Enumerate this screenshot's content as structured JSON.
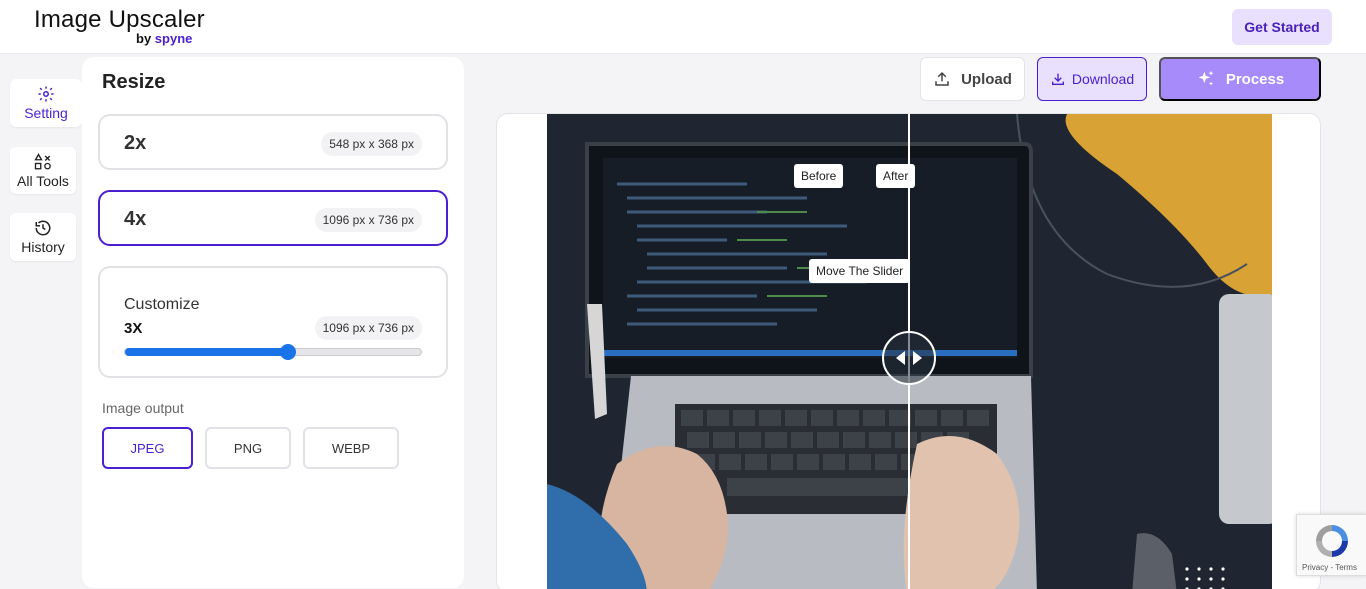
{
  "header": {
    "logo_title": "Image Upscaler",
    "logo_by": "by",
    "logo_brand": "spyne",
    "get_started": "Get Started"
  },
  "rail": {
    "setting": "Setting",
    "all_tools": "All Tools",
    "history": "History"
  },
  "panel": {
    "title": "Resize",
    "options": [
      {
        "label": "2x",
        "dims": "548 px x 368 px"
      },
      {
        "label": "4x",
        "dims": "1096 px x 736 px"
      }
    ],
    "customize": {
      "title": "Customize",
      "value": "3X",
      "dims": "1096 px x 736 px",
      "slider_fraction": 0.55
    },
    "output_label": "Image output",
    "formats": [
      "JPEG",
      "PNG",
      "WEBP"
    ],
    "selected_format": "JPEG"
  },
  "toolbar": {
    "upload": "Upload",
    "download": "Download",
    "process": "Process"
  },
  "viewer": {
    "before": "Before",
    "after": "After",
    "move_hint": "Move The Slider"
  },
  "recaptcha": {
    "links": "Privacy - Terms"
  },
  "colors": {
    "accent": "#4a1fd0",
    "accent_light": "#e8e0fd",
    "process": "#a78bfa",
    "slider": "#1a73e8"
  }
}
